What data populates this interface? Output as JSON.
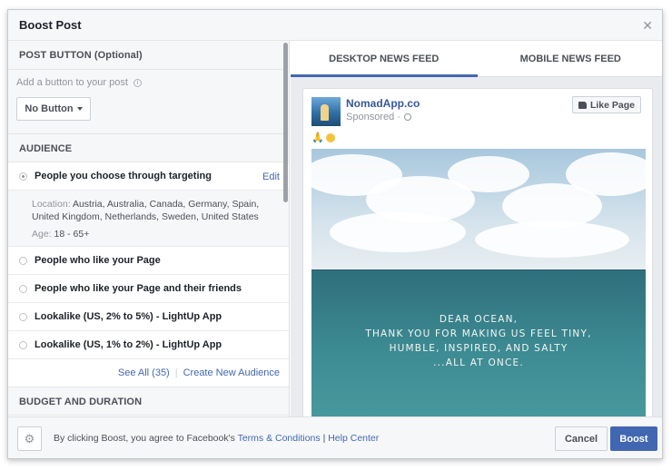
{
  "modal": {
    "title": "Boost Post"
  },
  "left": {
    "post_button": {
      "heading": "POST BUTTON (Optional)",
      "hint": "Add a button to your post",
      "select_value": "No Button"
    },
    "audience": {
      "heading": "AUDIENCE",
      "selected": {
        "label": "People you choose through targeting",
        "edit": "Edit",
        "location_key": "Location:",
        "location_value": "Austria, Australia, Canada, Germany, Spain, United Kingdom, Netherlands, Sweden, United States",
        "age_key": "Age:",
        "age_value": "18 - 65+"
      },
      "options": [
        "People who like your Page",
        "People who like your Page and their friends",
        "Lookalike (US, 2% to 5%) - LightUp App",
        "Lookalike (US, 1% to 2%) - LightUp App"
      ],
      "see_all": "See All (35)",
      "create_new": "Create New Audience"
    },
    "budget": {
      "heading": "BUDGET AND DURATION"
    }
  },
  "preview": {
    "tabs": [
      "DESKTOP NEWS FEED",
      "MOBILE NEWS FEED"
    ],
    "active_tab": 0,
    "page_name": "NomadApp.co",
    "sponsored": "Sponsored ·",
    "like_page": "Like Page",
    "emoji_text": "🙏",
    "quote_lines": [
      "DEAR OCEAN,",
      "THANK YOU FOR MAKING US FEEL TINY,",
      "HUMBLE, INSPIRED, AND SALTY",
      "...ALL AT ONCE."
    ]
  },
  "footer": {
    "agree_prefix": "By clicking Boost, you agree to Facebook's",
    "terms": "Terms & Conditions",
    "divider": "|",
    "help": "Help Center",
    "cancel": "Cancel",
    "boost": "Boost"
  },
  "colors": {
    "accent": "#4267b2",
    "link": "#365899"
  }
}
